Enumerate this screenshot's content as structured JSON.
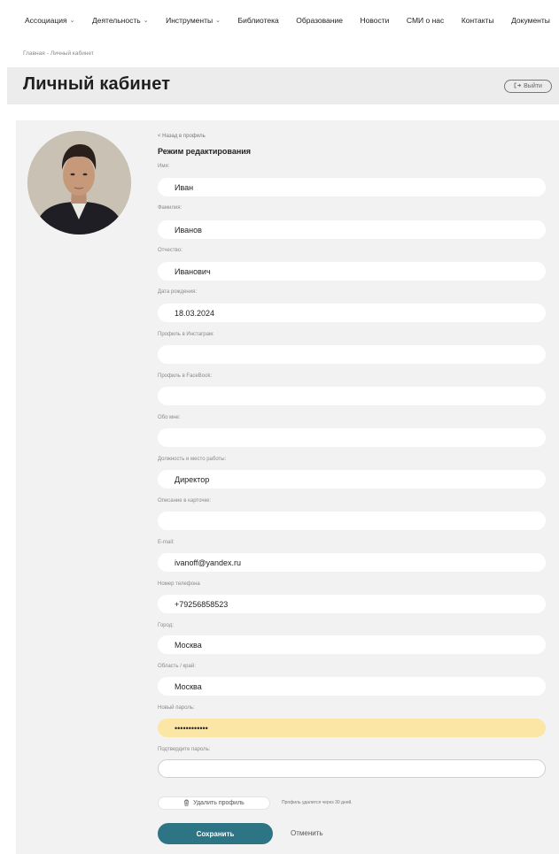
{
  "nav": {
    "items": [
      {
        "label": "Ассоциация",
        "dropdown": true
      },
      {
        "label": "Деятельность",
        "dropdown": true
      },
      {
        "label": "Инструменты",
        "dropdown": true
      },
      {
        "label": "Библиотека",
        "dropdown": false
      },
      {
        "label": "Образование",
        "dropdown": false
      },
      {
        "label": "Новости",
        "dropdown": false
      },
      {
        "label": "СМИ о нас",
        "dropdown": false
      },
      {
        "label": "Контакты",
        "dropdown": false
      },
      {
        "label": "Документы",
        "dropdown": false
      }
    ]
  },
  "breadcrumb": {
    "home": "Главная",
    "separator": "-",
    "current": "Личный кабинет"
  },
  "header": {
    "title": "Личный кабинет",
    "logout_label": "Выйти",
    "logout_icon": "logout-icon"
  },
  "profile": {
    "back_link": "< Назад в профиль",
    "mode_title": "Режим редактирования",
    "fields": {
      "first_name": {
        "label": "Имя:",
        "value": "Иван"
      },
      "last_name": {
        "label": "Фамилия:",
        "value": "Иванов"
      },
      "patronymic": {
        "label": "Отчество:",
        "value": "Иванович"
      },
      "birth_date": {
        "label": "Дата рождения:",
        "value": "18.03.2024"
      },
      "instagram": {
        "label": "Профиль в Инстаграм:",
        "value": ""
      },
      "facebook": {
        "label": "Профиль в FaceBook:",
        "value": ""
      },
      "about": {
        "label": "Обо мне:",
        "value": ""
      },
      "position": {
        "label": "Должность и место работы:",
        "value": "Директор"
      },
      "card_desc": {
        "label": "Описание в карточке:",
        "value": ""
      },
      "email": {
        "label": "E-mail:",
        "value": "ivanoff@yandex.ru"
      },
      "phone": {
        "label": "Номер телефона",
        "value": "+79256858523"
      },
      "city": {
        "label": "Город:",
        "value": "Москва"
      },
      "region": {
        "label": "Область / край:",
        "value": "Москва"
      },
      "new_password": {
        "label": "Новый пароль:",
        "value": "••••••••••••"
      },
      "confirm_password": {
        "label": "Подтвердите пароль:",
        "value": ""
      }
    },
    "delete_label": "Удалить профиль",
    "delete_icon": "trash-icon",
    "delete_note": "Профиль удалится через 30 дней.",
    "save_label": "Сохранить",
    "cancel_label": "Отменить"
  },
  "colors": {
    "accent": "#2d7585",
    "autofill": "#fbe6a6",
    "panel": "#f2f2f2",
    "titlebar": "#ececec"
  }
}
